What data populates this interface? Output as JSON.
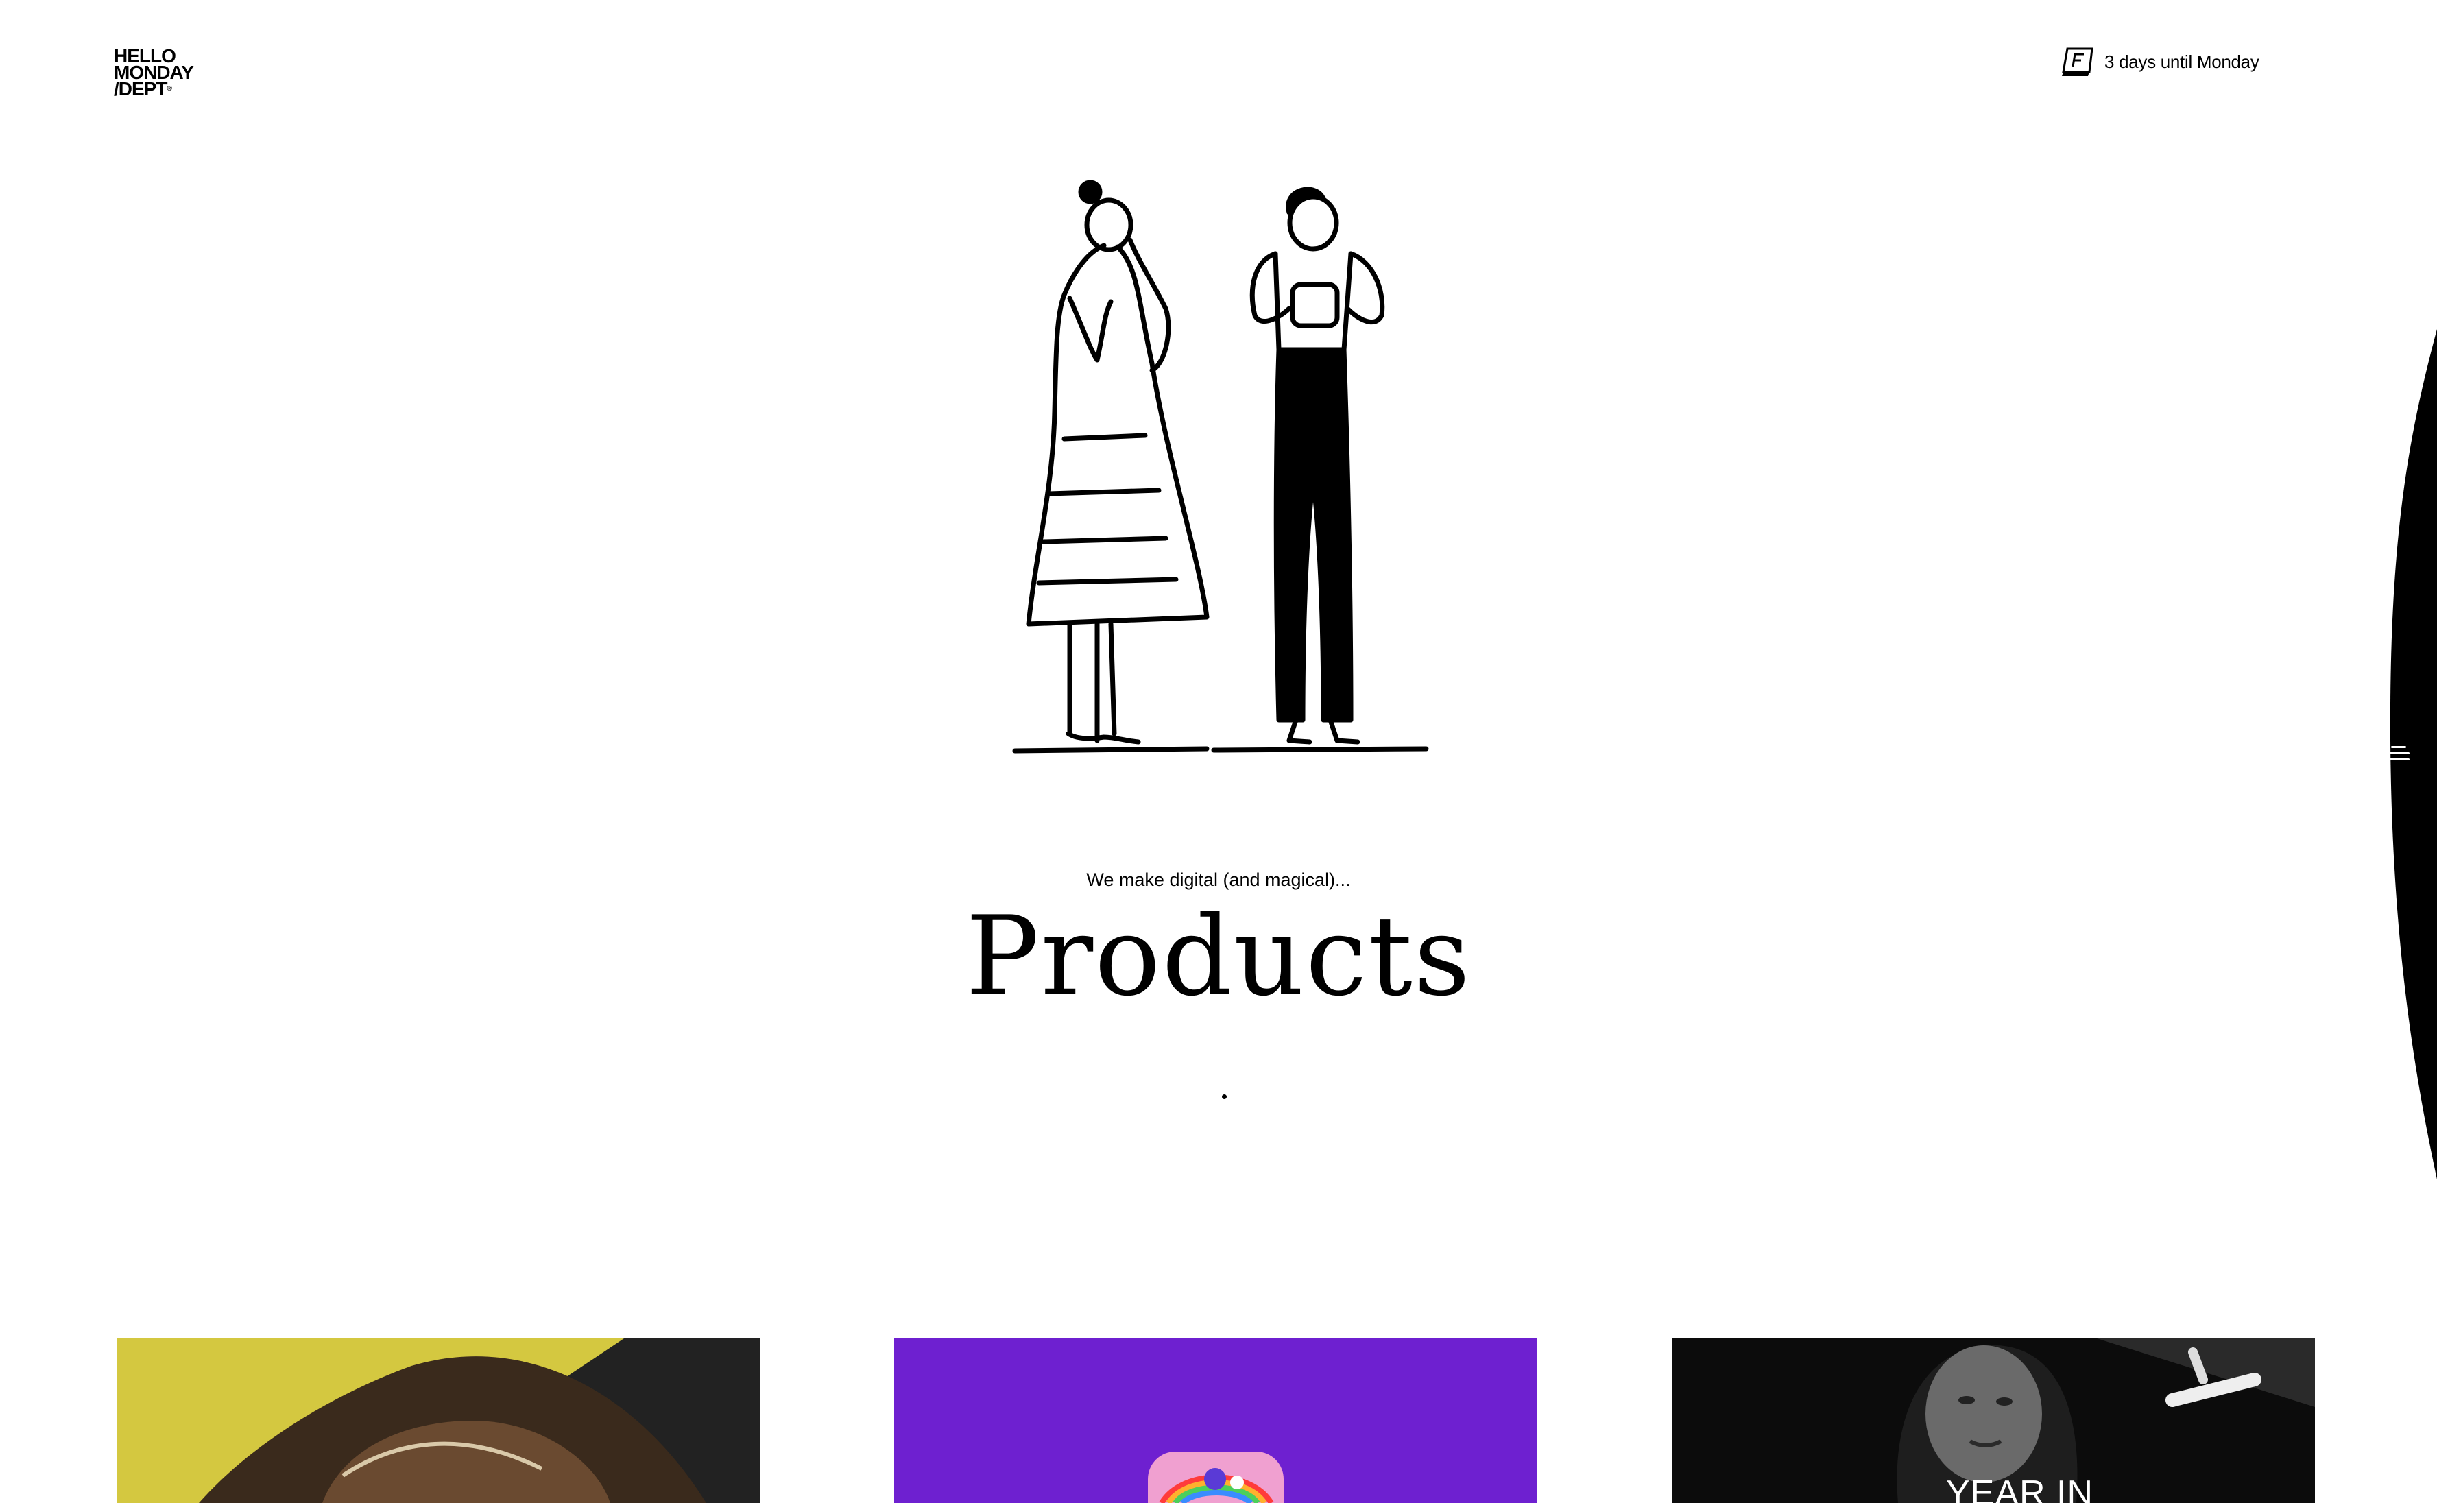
{
  "header": {
    "logo": {
      "line1": "HELLO",
      "line2": "MONDAY",
      "line3": "/DEPT",
      "mark": "®"
    },
    "countdown": {
      "icon": "calendar-icon",
      "text": "3 days until Monday"
    }
  },
  "hero": {
    "illustration": "two-people-illustration",
    "eyebrow": "We make digital (and magical)...",
    "title": "Products"
  },
  "navigation": {
    "menu_icon": "hamburger-icon"
  },
  "cards": [
    {
      "background": "#d4c840",
      "image": "portrait-photo"
    },
    {
      "background": "#6e20d0",
      "image": "rainbow-app-icon"
    },
    {
      "background": "#0c0c0c",
      "image": "portrait-photo",
      "caption": "YEAR IN"
    }
  ]
}
